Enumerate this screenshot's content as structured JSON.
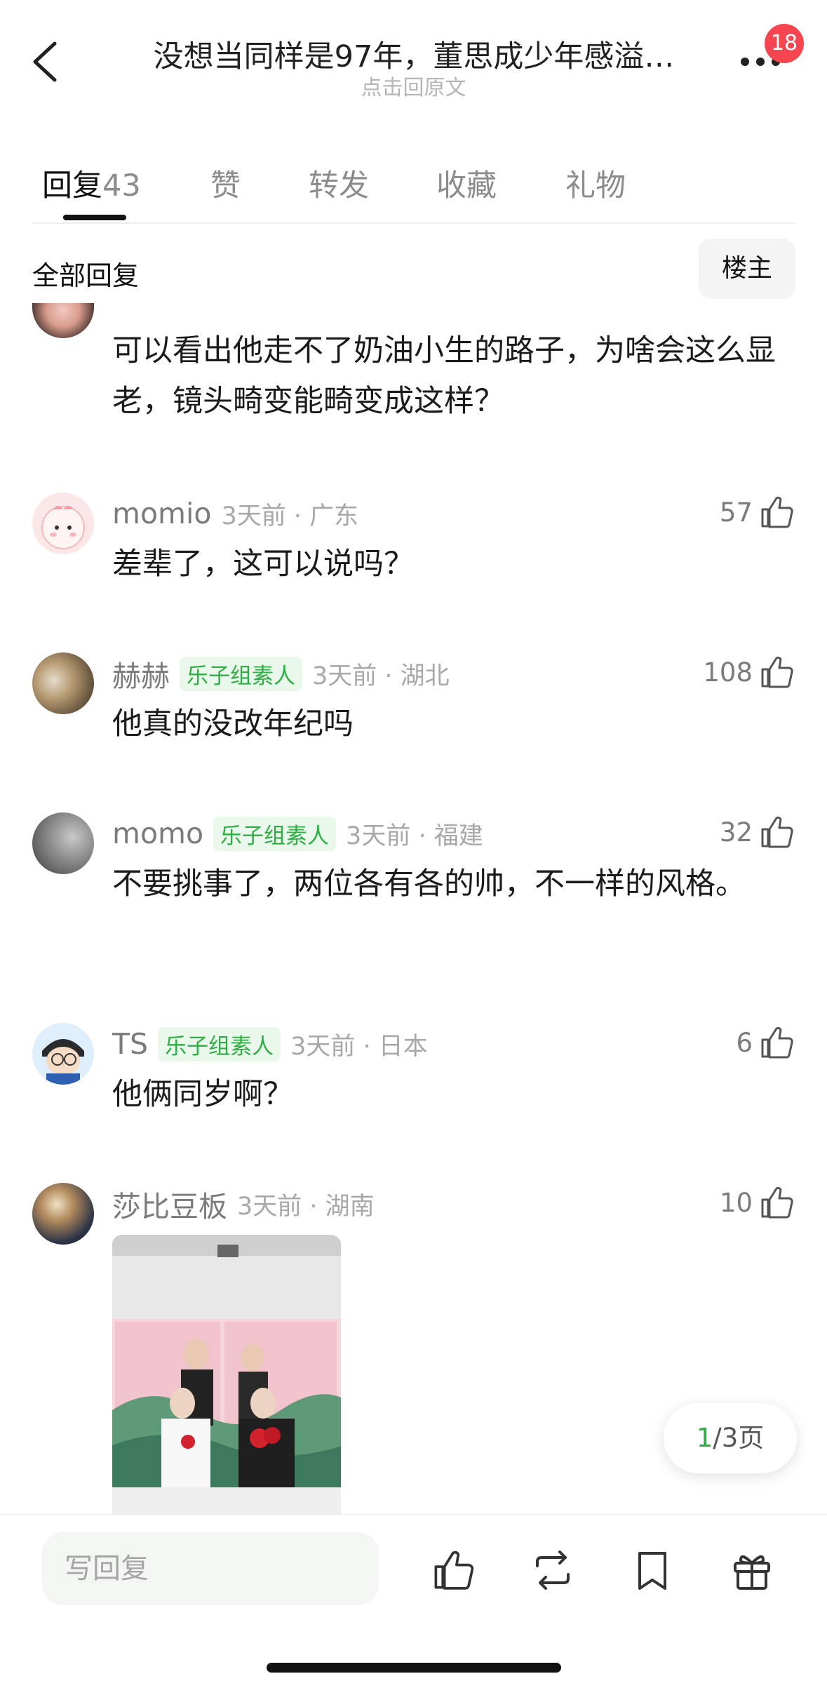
{
  "header": {
    "title": "没想当同样是97年，董思成少年感溢…",
    "subtitle": "点击回原文",
    "badge_count": "18"
  },
  "tabs": [
    {
      "label": "回复",
      "count": "43",
      "active": true
    },
    {
      "label": "赞"
    },
    {
      "label": "转发"
    },
    {
      "label": "收藏"
    },
    {
      "label": "礼物"
    }
  ],
  "filter": {
    "label": "全部回复",
    "op_button": "楼主"
  },
  "comments": [
    {
      "body": "可以看出他走不了奶油小生的路子，为啥会这么显老，镜头畸变能畸变成这样？"
    },
    {
      "username": "momio",
      "time": "3天前 · 广东",
      "likes": "57",
      "body": "差辈了，这可以说吗？"
    },
    {
      "username": "赫赫",
      "tag": "乐子组素人",
      "time": "3天前 · 湖北",
      "likes": "108",
      "body": "他真的没改年纪吗"
    },
    {
      "username": "momo",
      "tag": "乐子组素人",
      "time": "3天前 · 福建",
      "likes": "32",
      "body": "不要挑事了，两位各有各的帅，不一样的风格。"
    },
    {
      "username": "TS",
      "tag": "乐子组素人",
      "time": "3天前 · 日本",
      "likes": "6",
      "body": "他俩同岁啊？"
    },
    {
      "username": "莎比豆板",
      "time": "3天前 · 湖南",
      "likes": "10"
    }
  ],
  "pager": {
    "current": "1",
    "total_text": "/3页"
  },
  "bottom_bar": {
    "reply_placeholder": "写回复"
  },
  "icons": {
    "back": "chevron-left-icon",
    "more": "more-dots-icon",
    "like": "thumbs-up-icon",
    "repost": "repost-icon",
    "bookmark": "bookmark-icon",
    "gift": "gift-icon"
  },
  "colors": {
    "accent_green": "#2fae45",
    "badge_red": "#f54550"
  }
}
